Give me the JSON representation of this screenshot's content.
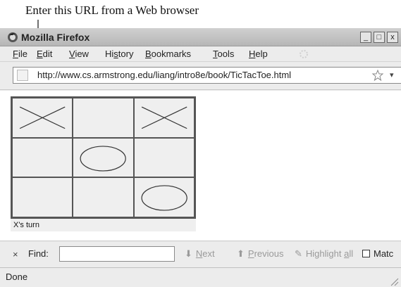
{
  "annotation": {
    "text": "Enter this URL from a Web browser"
  },
  "window": {
    "title": "Mozilla Firefox",
    "controls": {
      "minimize": "_",
      "maximize": "□",
      "close": "x"
    }
  },
  "menubar": {
    "items": [
      {
        "accel": "F",
        "rest": "ile"
      },
      {
        "accel": "E",
        "rest": "dit"
      },
      {
        "accel": "V",
        "rest": "iew"
      },
      {
        "pre": "Hi",
        "accel": "s",
        "rest": "tory"
      },
      {
        "accel": "B",
        "rest": "ookmarks"
      },
      {
        "accel": "T",
        "rest": "ools"
      },
      {
        "accel": "H",
        "rest": "elp"
      }
    ]
  },
  "navbar": {
    "url": "http://www.cs.armstrong.edu/liang/intro8e/book/TicTacToe.html"
  },
  "game": {
    "board": [
      [
        "X",
        "",
        "X"
      ],
      [
        "",
        "O",
        ""
      ],
      [
        "",
        "",
        "O"
      ]
    ],
    "status": "X's turn"
  },
  "findbar": {
    "close": "×",
    "label": "Find:",
    "value": "",
    "next": {
      "accel": "N",
      "rest": "ext"
    },
    "previous": {
      "accel": "P",
      "rest": "revious"
    },
    "highlight": {
      "text": "Highlight ",
      "accel": "a",
      "rest": "ll"
    },
    "match_case": "Matc"
  },
  "statusbar": {
    "text": "Done"
  },
  "icons": {
    "app": "firefox-icon",
    "site": "site-identity-icon",
    "bookmark": "star-icon",
    "throbber": "throbber-icon",
    "arrow": "down-arrow-icon"
  }
}
